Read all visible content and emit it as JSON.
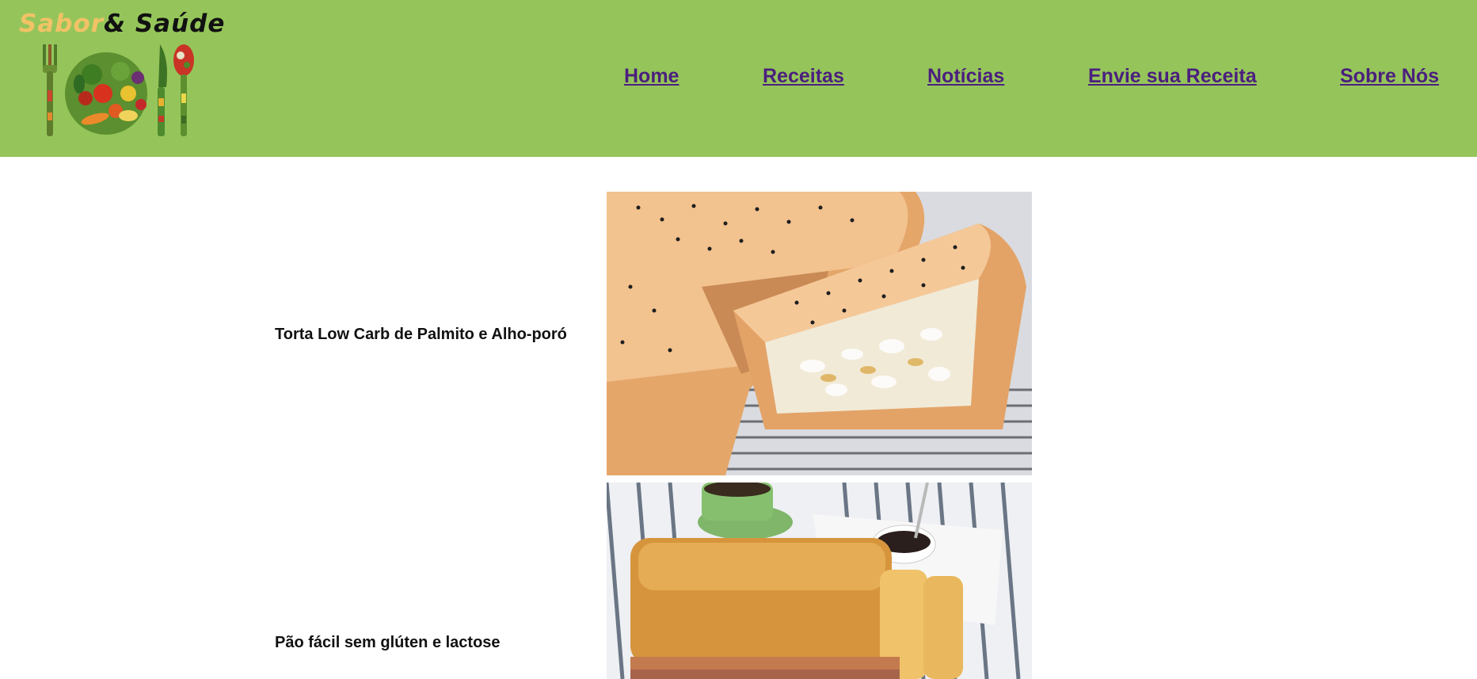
{
  "brand": {
    "word1": "Sabor",
    "word2": "& Saúde"
  },
  "nav": {
    "items": [
      {
        "label": "Home"
      },
      {
        "label": "Receitas"
      },
      {
        "label": "Notícias"
      },
      {
        "label": "Envie sua Receita"
      },
      {
        "label": "Sobre Nós"
      }
    ]
  },
  "recipes": [
    {
      "title": "Torta Low Carb de Palmito e Alho-poró"
    },
    {
      "title": "Pão fácil sem glúten e lactose"
    }
  ],
  "colors": {
    "header_bg": "#95c55a",
    "nav_link": "#4b1f7e",
    "brand_accent": "#f2c266"
  }
}
